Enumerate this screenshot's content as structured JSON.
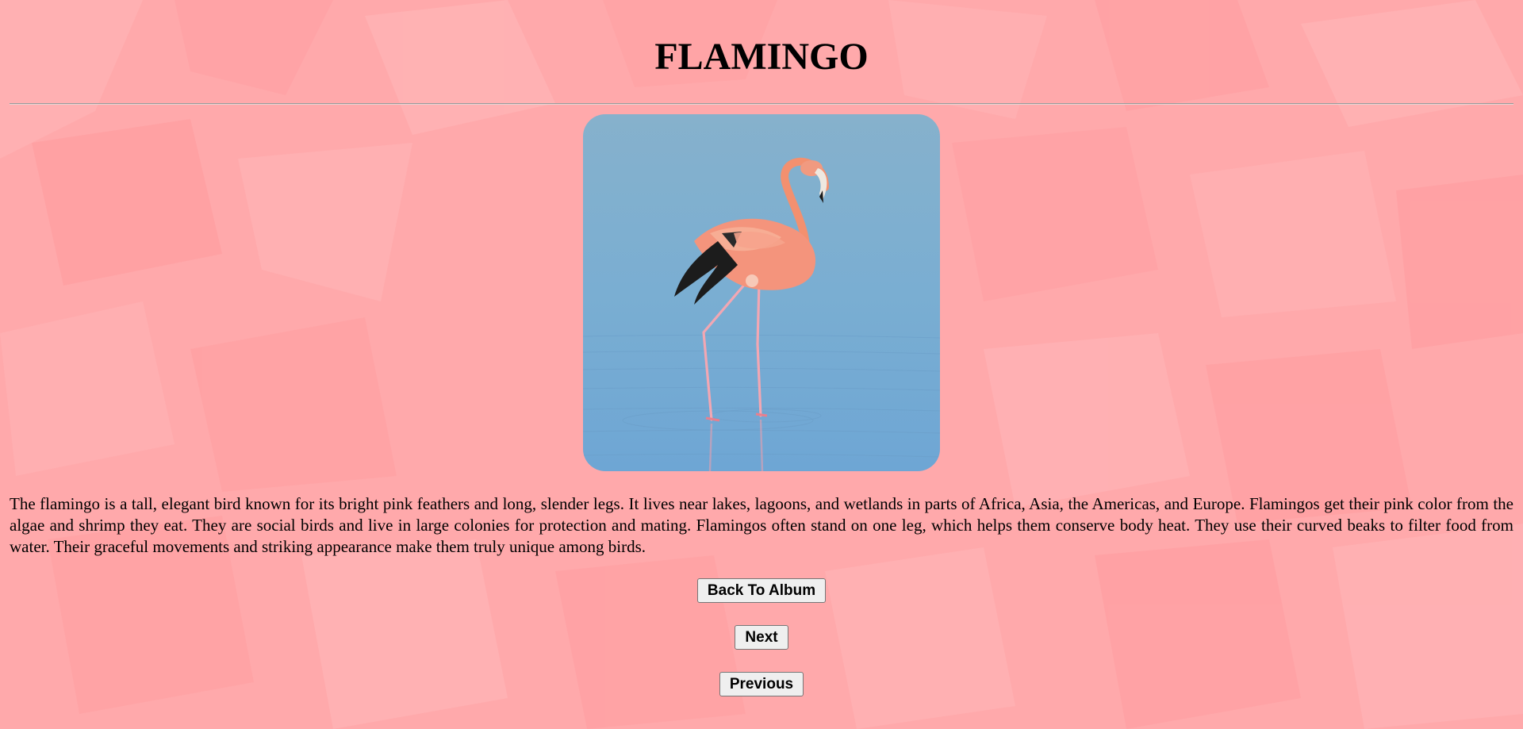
{
  "page": {
    "title": "FLAMINGO",
    "description": "The flamingo is a tall, elegant bird known for its bright pink feathers and long, slender legs. It lives near lakes, lagoons, and wetlands in parts of Africa, Asia, the Americas, and Europe. Flamingos get their pink color from the algae and shrimp they eat. They are social birds and live in large colonies for protection and mating. Flamingos often stand on one leg, which helps them conserve body heat. They use their curved beaks to filter food from water. Their graceful movements and striking appearance make them truly unique among birds."
  },
  "buttons": {
    "back_label": "Back To Album",
    "next_label": "Next",
    "previous_label": "Previous"
  },
  "colors": {
    "background": "#ffaaac",
    "water": "#7fb0d0",
    "flamingo": "#f4947c",
    "wing_black": "#1a1a1a"
  }
}
